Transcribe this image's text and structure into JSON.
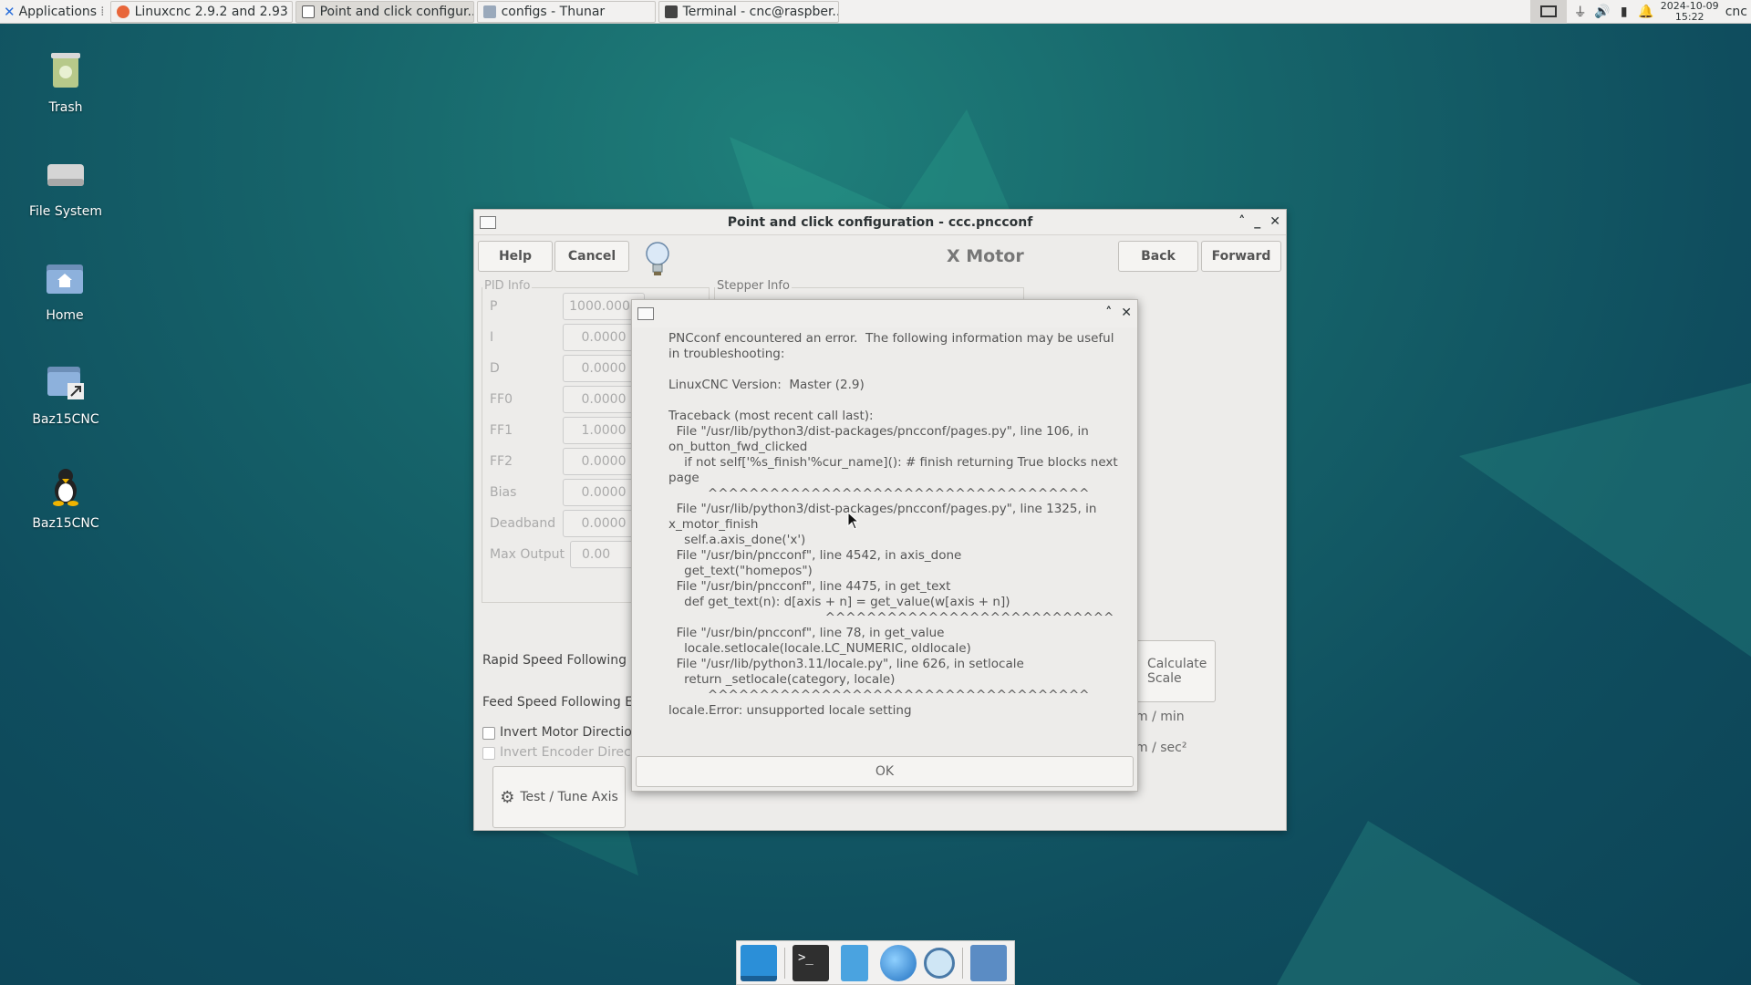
{
  "panel": {
    "apps_label": "Applications",
    "tasks": [
      {
        "label": "Linuxcnc 2.9.2 and 2.93 ..."
      },
      {
        "label": "Point and click configur..."
      },
      {
        "label": "configs - Thunar"
      },
      {
        "label": "Terminal - cnc@raspber..."
      }
    ],
    "date": "2024-10-09",
    "time": "15:22",
    "user": "cnc"
  },
  "desktop": {
    "icons": [
      {
        "label": "Trash"
      },
      {
        "label": "File System"
      },
      {
        "label": "Home"
      },
      {
        "label": "Baz15CNC"
      },
      {
        "label": "Baz15CNC"
      }
    ]
  },
  "main_window": {
    "title": "Point and click configuration - ccc.pncconf",
    "help": "Help",
    "cancel": "Cancel",
    "section_title": "X Motor",
    "back": "Back",
    "forward": "Forward",
    "pid_info_label": "PID Info",
    "stepper_info_label": "Stepper Info",
    "pid_rows": [
      {
        "label": "P",
        "value": "1000.0000"
      },
      {
        "label": "I",
        "value": "0.0000"
      },
      {
        "label": "D",
        "value": "0.0000"
      },
      {
        "label": "FF0",
        "value": "0.0000"
      },
      {
        "label": "FF1",
        "value": "1.0000"
      },
      {
        "label": "FF2",
        "value": "0.0000"
      },
      {
        "label": "Bias",
        "value": "0.0000"
      },
      {
        "label": "Deadband",
        "value": "0.0000"
      }
    ],
    "max_output_label": "Max Output",
    "max_output_value": "0.00",
    "rapid_label": "Rapid Speed Following Er",
    "feed_label": "Feed Speed Following Err",
    "invert_motor": "Invert Motor Direction",
    "invert_encoder": "Invert Encoder Directi",
    "test_tune": "Test / Tune Axis",
    "calculate_scale_1": "Calculate",
    "calculate_scale_2": "Scale",
    "unit_min": "m / min",
    "unit_sec": "m / sec²"
  },
  "error_dialog": {
    "text": "PNCconf encountered an error.  The following information may be useful\nin troubleshooting:\n\nLinuxCNC Version:  Master (2.9)\n\nTraceback (most recent call last):\n  File \"/usr/lib/python3/dist-packages/pncconf/pages.py\", line 106, in\non_button_fwd_clicked\n    if not self['%s_finish'%cur_name](): # finish returning True blocks next\npage\n          ^^^^^^^^^^^^^^^^^^^^^^^^^^^^^^^^^^^^^\n  File \"/usr/lib/python3/dist-packages/pncconf/pages.py\", line 1325, in\nx_motor_finish\n    self.a.axis_done('x')\n  File \"/usr/bin/pncconf\", line 4542, in axis_done\n    get_text(\"homepos\")\n  File \"/usr/bin/pncconf\", line 4475, in get_text\n    def get_text(n): d[axis + n] = get_value(w[axis + n])\n                                        ^^^^^^^^^^^^^^^^^^^^^^^^^^^^\n  File \"/usr/bin/pncconf\", line 78, in get_value\n    locale.setlocale(locale.LC_NUMERIC, oldlocale)\n  File \"/usr/lib/python3.11/locale.py\", line 626, in setlocale\n    return _setlocale(category, locale)\n          ^^^^^^^^^^^^^^^^^^^^^^^^^^^^^^^^^^^^^\nlocale.Error: unsupported locale setting",
    "ok": "OK"
  },
  "dock": {
    "items": [
      "show-desktop",
      "terminal",
      "file-manager",
      "web-browser",
      "app-finder",
      "folder"
    ]
  }
}
